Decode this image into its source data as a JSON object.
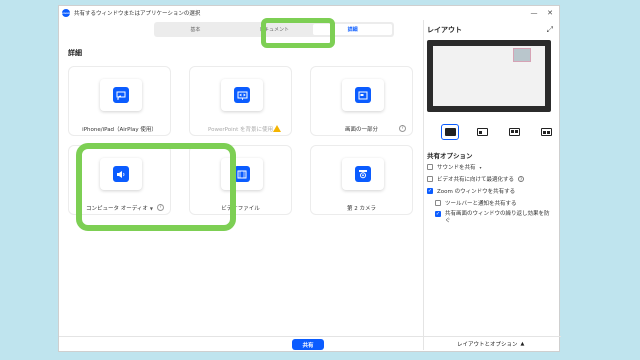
{
  "window": {
    "title": "共有するウィンドウまたはアプリケーションの選択",
    "logo_text": "zoom",
    "controls": [
      "—",
      "✕"
    ]
  },
  "tabs": [
    {
      "label": "基本",
      "active": false
    },
    {
      "label": "ドキュメント",
      "active": false
    },
    {
      "label": "詳細",
      "active": true
    }
  ],
  "section_title": "詳細",
  "cards": [
    {
      "label": "iPhone/iPad（AirPlay 使用）",
      "icon": "airplay-icon",
      "dim": false
    },
    {
      "label": "PowerPoint を背景に使用",
      "icon": "powerpoint-background-icon",
      "dim": true,
      "warning": true
    },
    {
      "label": "画面の一部分",
      "icon": "portion-of-screen-icon",
      "dim": false,
      "info": true
    },
    {
      "label": "コンピュータ オーディオ",
      "icon": "speaker-icon",
      "dim": false,
      "info": true,
      "dropdown": true
    },
    {
      "label": "ビデオファイル",
      "icon": "video-file-icon",
      "dim": false
    },
    {
      "label": "第 2 カメラ",
      "icon": "camera-icon",
      "dim": false
    }
  ],
  "right_panel": {
    "title": "レイアウト",
    "options_title": "共有オプション",
    "options": [
      {
        "label": "サウンドを共有",
        "checked": false,
        "dropdown": true
      },
      {
        "label": "ビデオ共有に向けて最適化する",
        "checked": false,
        "help": true
      },
      {
        "label": "Zoom のウィンドウを共有する",
        "checked": true
      },
      {
        "label": "ツールバーと通知を共有する",
        "checked": false,
        "indent": true
      },
      {
        "label": "共有画面のウィンドウの繰り返し効果を防ぐ",
        "checked": true,
        "indent": true
      }
    ]
  },
  "footer": {
    "share_label": "共有",
    "layout_options_label": "レイアウトとオプション"
  },
  "colors": {
    "accent": "#0b5cff",
    "highlight": "#7dcf54",
    "backdrop": "#bfe4ee"
  }
}
